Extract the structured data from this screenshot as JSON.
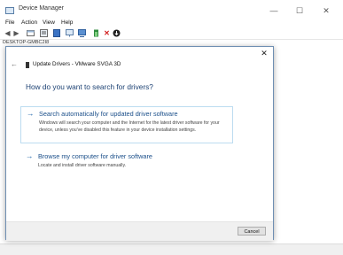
{
  "window": {
    "title": "Device Manager",
    "controls": {
      "minimize": "—",
      "maximize": "☐",
      "close": "✕"
    }
  },
  "menu": [
    "File",
    "Action",
    "View",
    "Help"
  ],
  "toolbar_icons": [
    "back-icon",
    "forward-icon",
    "properties-icon",
    "help-icon",
    "computer-icon",
    "monitor-icon",
    "update-driver-icon",
    "uninstall-icon",
    "download-icon"
  ],
  "tree": {
    "root_label": "DESKTOP-GMBC2I8"
  },
  "dialog": {
    "close_glyph": "✕",
    "back_glyph": "←",
    "title": "Update Drivers - VMware SVGA 3D",
    "heading": "How do you want to search for drivers?",
    "options": [
      {
        "arrow": "→",
        "title": "Search automatically for updated driver software",
        "description": "Windows will search your computer and the Internet for the latest driver software for your device, unless you've disabled this feature in your device installation settings."
      },
      {
        "arrow": "→",
        "title": "Browse my computer for driver software",
        "description": "Locate and install driver software manually."
      }
    ],
    "cancel_label": "Cancel"
  },
  "colors": {
    "accent": "#1b4f8a",
    "heading": "#1c4173",
    "selection_border": "#bcdcf0",
    "desktop": "#c9dff0"
  }
}
